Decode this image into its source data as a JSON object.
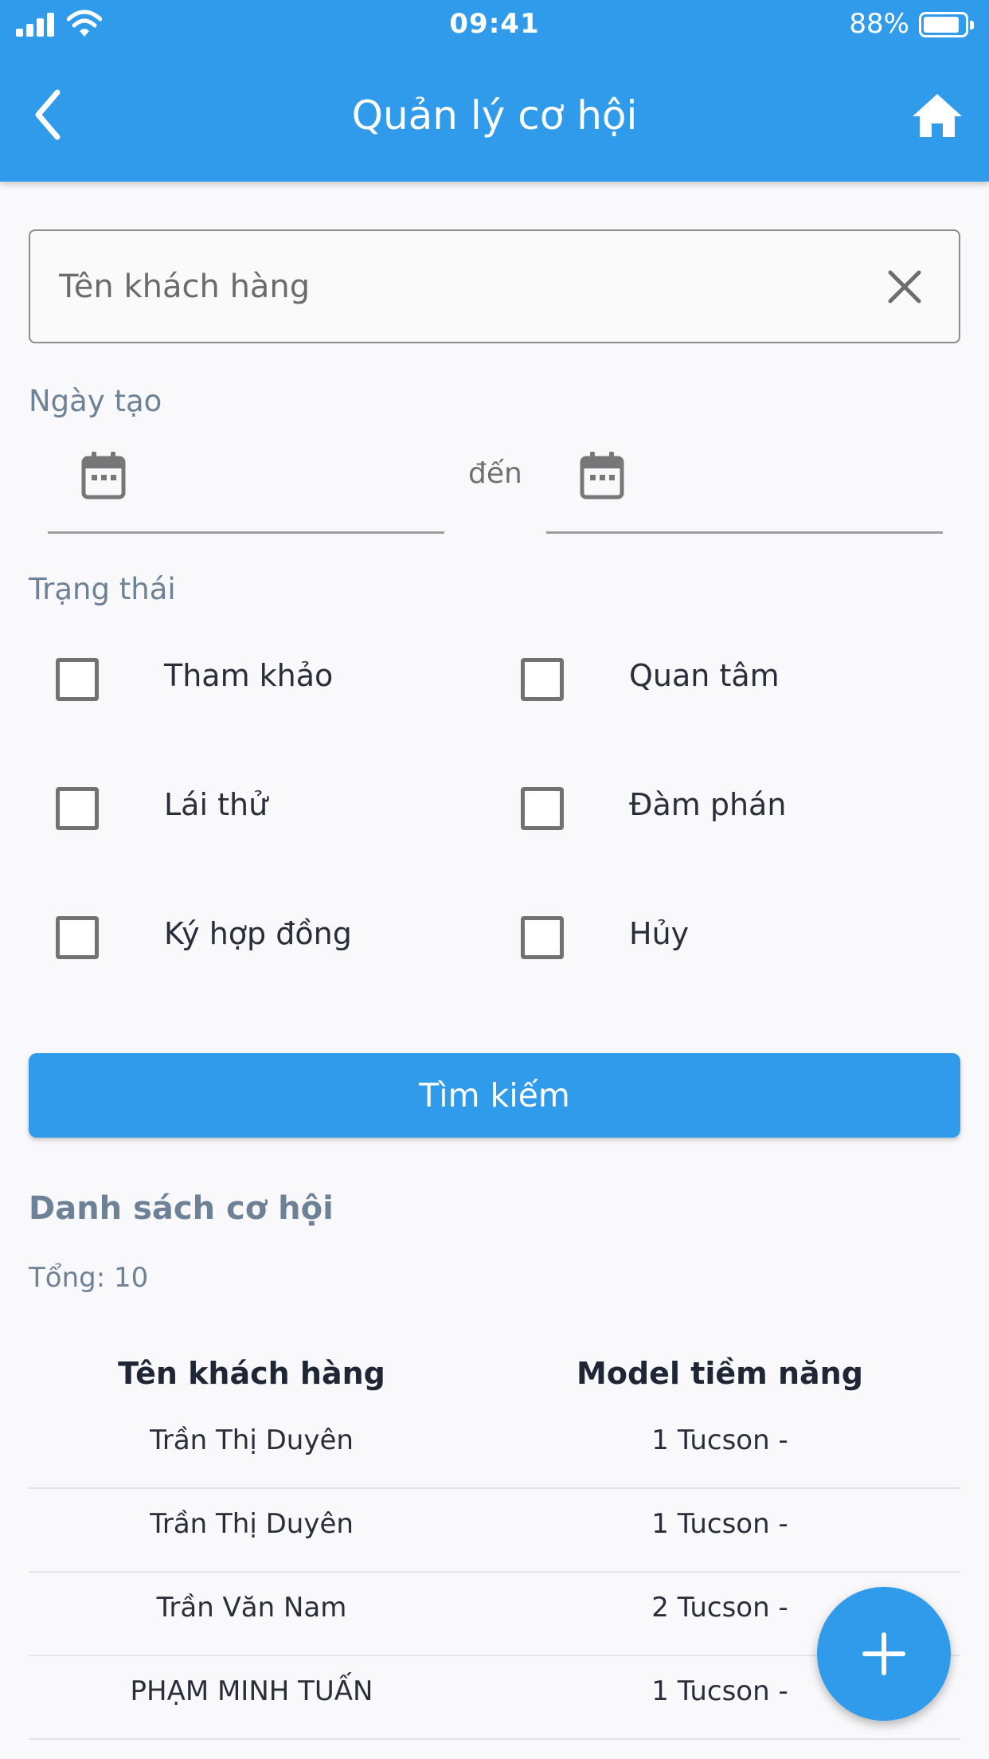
{
  "status_bar": {
    "time": "09:41",
    "battery": "88%"
  },
  "header": {
    "title": "Quản lý cơ hội",
    "back_icon": "chevron-left-icon",
    "home_icon": "home-icon"
  },
  "search": {
    "placeholder": "Tên khách hàng",
    "value": ""
  },
  "date_filter": {
    "label": "Ngày tạo",
    "separator": "đến",
    "from": "",
    "to": ""
  },
  "status_filter": {
    "label": "Trạng thái",
    "options": [
      "Tham khảo",
      "Quan tâm",
      "Lái thử",
      "Đàm phán",
      "Ký hợp đồng",
      "Hủy"
    ]
  },
  "search_button": {
    "label": "Tìm kiếm"
  },
  "list": {
    "title": "Danh sách cơ hội",
    "total": "Tổng: 10",
    "columns": [
      "Tên khách hàng",
      "Model tiềm năng"
    ],
    "rows": [
      [
        "Trần Thị Duyên",
        "1 Tucson -"
      ],
      [
        "Trần Thị Duyên",
        "1 Tucson -"
      ],
      [
        "Trần Văn Nam",
        "2 Tucson -"
      ],
      [
        "PHẠM MINH TUẤN",
        "1 Tucson -"
      ]
    ]
  },
  "colors": {
    "primary": "#2f9bea",
    "muted_label": "#6d8197",
    "text": "#2a2e3a"
  }
}
